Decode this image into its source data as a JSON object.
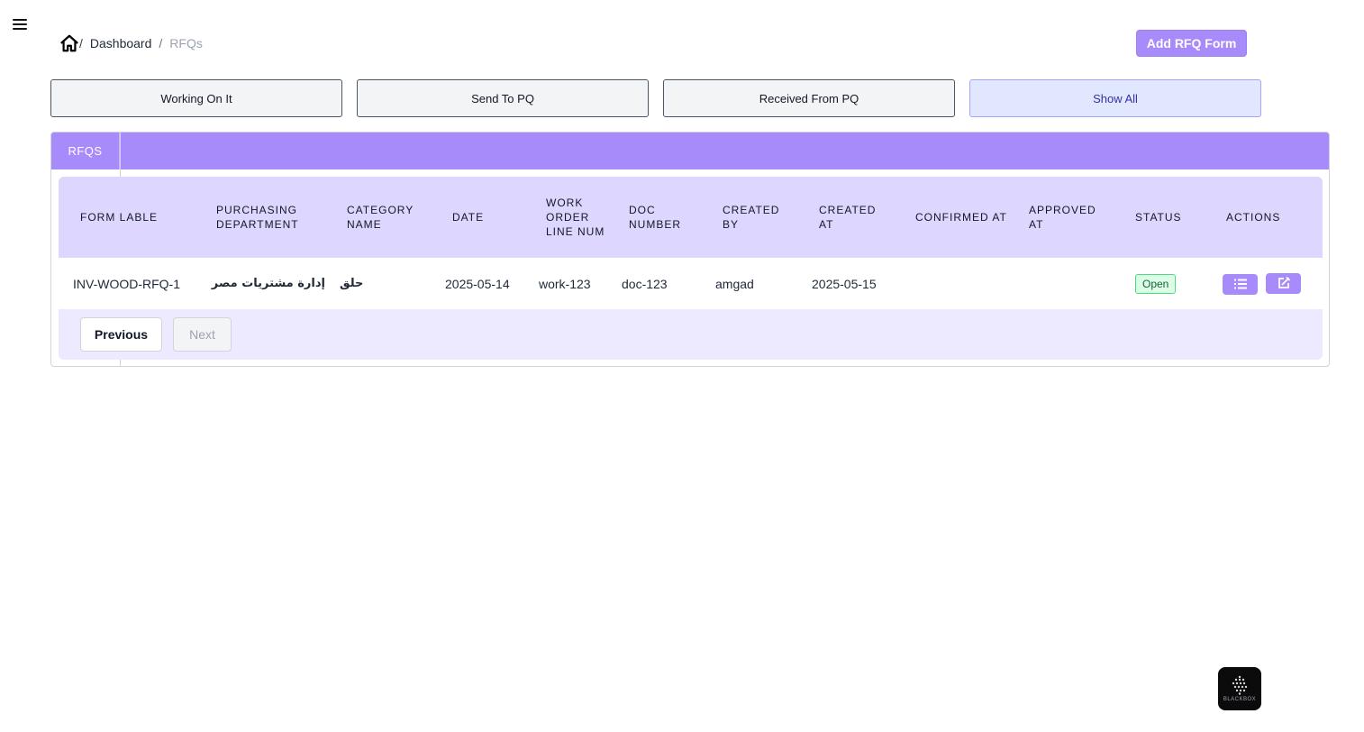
{
  "breadcrumb": {
    "separator": "/",
    "dashboard": "Dashboard",
    "current": "RFQs"
  },
  "header": {
    "add_button": "Add RFQ Form"
  },
  "filters": [
    {
      "label": "Working On It",
      "active": false
    },
    {
      "label": "Send To PQ",
      "active": false
    },
    {
      "label": "Received From PQ",
      "active": false
    },
    {
      "label": "Show All",
      "active": true
    }
  ],
  "panel": {
    "tab_label": "RFQS"
  },
  "table": {
    "columns": [
      "Form lable",
      "Purchasing Department",
      "Category Name",
      "Date",
      "Work Order Line Num",
      "Doc Number",
      "Created By",
      "Created At",
      "Confirmed At",
      "Approved At",
      "Status",
      "Actions"
    ],
    "rows": [
      {
        "form_lable": "INV-WOOD-RFQ-1",
        "purchasing_department": "إدارة مشتريات مصر",
        "category_name": "حلق",
        "date": "2025-05-14",
        "work_order_line_num": "work-123",
        "doc_number": "doc-123",
        "created_by": "amgad",
        "created_at": "2025-05-15",
        "confirmed_at": "",
        "approved_at": "",
        "status": "Open"
      }
    ]
  },
  "pagination": {
    "previous": "Previous",
    "next": "Next"
  },
  "widget": {
    "label": "BLACKBOX"
  },
  "icons": {
    "menu": "hamburger-icon",
    "home": "home-icon",
    "view": "list-icon",
    "edit": "edit-icon"
  },
  "colors": {
    "accent": "#a78bfa",
    "header_row": "#ddd6fe",
    "status_open": "#166534"
  }
}
